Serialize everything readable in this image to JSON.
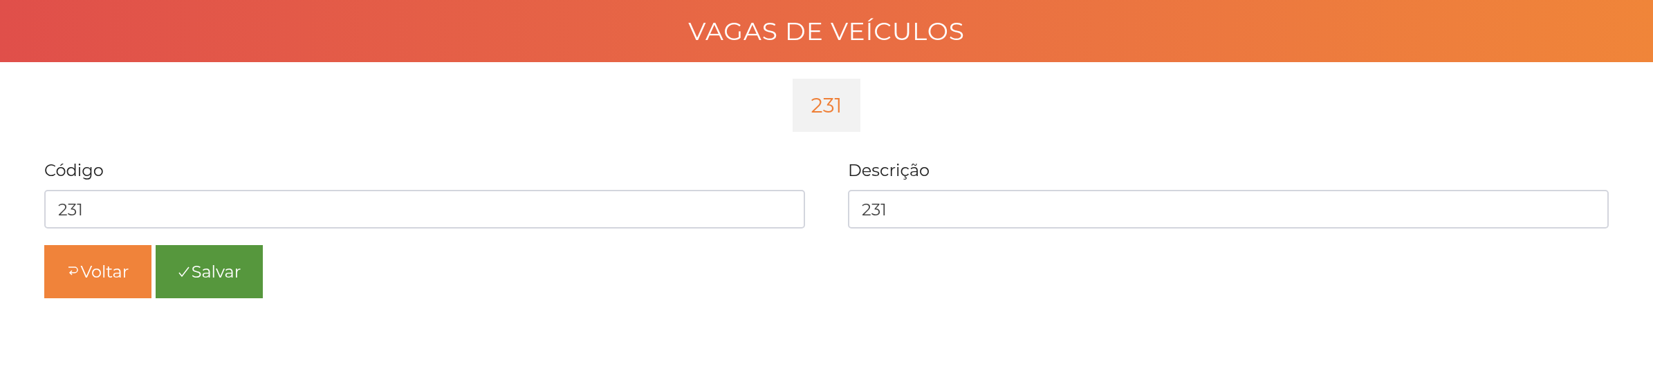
{
  "header": {
    "title": "VAGAS DE VEÍCULOS"
  },
  "badge": "231",
  "fields": [
    {
      "label": "Código",
      "value": "231"
    },
    {
      "label": "Descrição",
      "value": "231"
    }
  ],
  "buttons": [
    {
      "label": "Voltar",
      "kind": "back"
    },
    {
      "label": "Salvar",
      "kind": "save"
    }
  ]
}
